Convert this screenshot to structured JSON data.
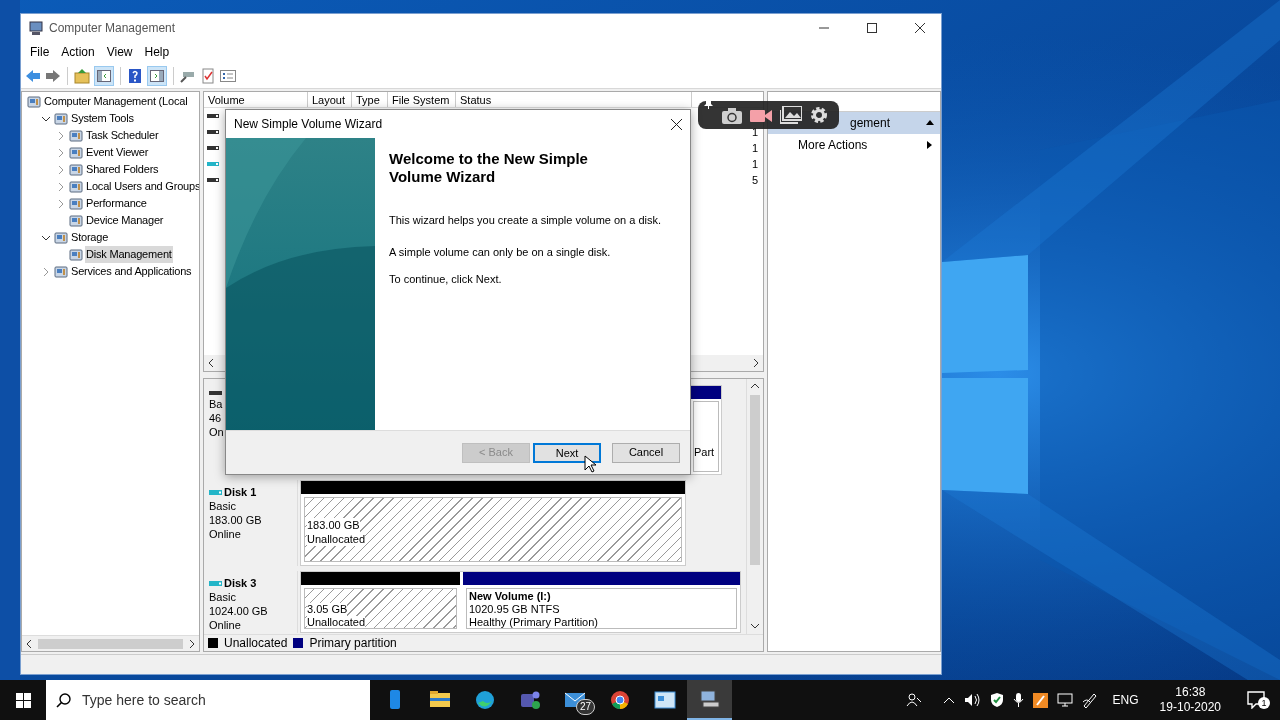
{
  "window": {
    "title": "Computer Management"
  },
  "menu": [
    "File",
    "Action",
    "View",
    "Help"
  ],
  "toolbar": {
    "toggles": [
      {
        "on": true
      },
      {
        "on": true
      }
    ]
  },
  "tree": {
    "items": [
      {
        "label": "Computer Management (Local",
        "selected": false,
        "children": [
          {
            "label": "System Tools",
            "expanded": true,
            "selected": false,
            "children": [
              {
                "label": "Task Scheduler",
                "expanded": false,
                "selected": false
              },
              {
                "label": "Event Viewer",
                "expanded": false,
                "selected": false
              },
              {
                "label": "Shared Folders",
                "expanded": false,
                "selected": false
              },
              {
                "label": "Local Users and Groups",
                "expanded": false,
                "selected": false
              },
              {
                "label": "Performance",
                "expanded": false,
                "selected": false
              },
              {
                "label": "Device Manager",
                "selected": false
              }
            ]
          },
          {
            "label": "Storage",
            "expanded": true,
            "selected": false,
            "children": [
              {
                "label": "Disk Management",
                "selected": true
              }
            ]
          },
          {
            "label": "Services and Applications",
            "expanded": false,
            "selected": false
          }
        ]
      }
    ]
  },
  "volume_list": {
    "columns": [
      "Volume",
      "Layout",
      "Type",
      "File System",
      "Status"
    ],
    "rows": [
      {
        "kind": "internal"
      },
      {
        "kind": "internal",
        "column_6": "1"
      },
      {
        "kind": "internal",
        "column_6": "1"
      },
      {
        "kind": "external",
        "column_6": "1"
      },
      {
        "kind": "internal",
        "column_6": "5"
      }
    ]
  },
  "disks": [
    {
      "lines": [
        "Ba",
        "46",
        "On"
      ],
      "partitions": [
        {
          "kind": "primary",
          "lines": [
            "Part"
          ]
        }
      ]
    },
    {
      "name": "Disk 1",
      "lines": [
        "Basic",
        "183.00 GB",
        "Online"
      ],
      "partitions": [
        {
          "kind": "unallocated",
          "lines": [
            "183.00 GB",
            "Unallocated"
          ]
        }
      ]
    },
    {
      "name": "Disk 3",
      "lines": [
        "Basic",
        "1024.00 GB",
        "Online"
      ],
      "partitions": [
        {
          "kind": "unallocated",
          "lines": [
            "3.05 GB",
            "Unallocated"
          ]
        },
        {
          "kind": "primary",
          "title": "New Volume  (I:)",
          "lines": [
            "1020.95 GB NTFS",
            "Healthy (Primary Partition)"
          ]
        }
      ]
    }
  ],
  "legend": [
    {
      "label": "Unallocated",
      "color": "#000000"
    },
    {
      "label": "Primary partition",
      "color": "#000080"
    }
  ],
  "actions": {
    "items": [
      {
        "label": "gement",
        "kind": "section"
      },
      {
        "label": "More Actions",
        "kind": "submenu"
      }
    ]
  },
  "dialog": {
    "title": "New Simple Volume Wizard",
    "heading": "Welcome to the New Simple Volume Wizard",
    "paragraphs": [
      "This wizard helps you create a simple volume on a disk.",
      "A simple volume can only be on a single disk.",
      "To continue, click Next."
    ],
    "buttons": [
      {
        "label": "< Back",
        "disabled": true,
        "focused": false
      },
      {
        "label": "Next",
        "disabled": false,
        "focused": true
      },
      {
        "label": "Cancel",
        "disabled": false,
        "focused": false
      }
    ]
  },
  "taskbar": {
    "search": {
      "placeholder": "Type here to search"
    },
    "apps": [
      {
        "active": false
      },
      {
        "active": false
      },
      {
        "active": false
      },
      {
        "active": false
      },
      {
        "active": false,
        "badge": "27"
      },
      {
        "active": false
      },
      {
        "active": false
      },
      {
        "active": true
      }
    ],
    "language": "ENG",
    "time": "16:38",
    "date": "19-10-2020",
    "notifications": "1"
  }
}
